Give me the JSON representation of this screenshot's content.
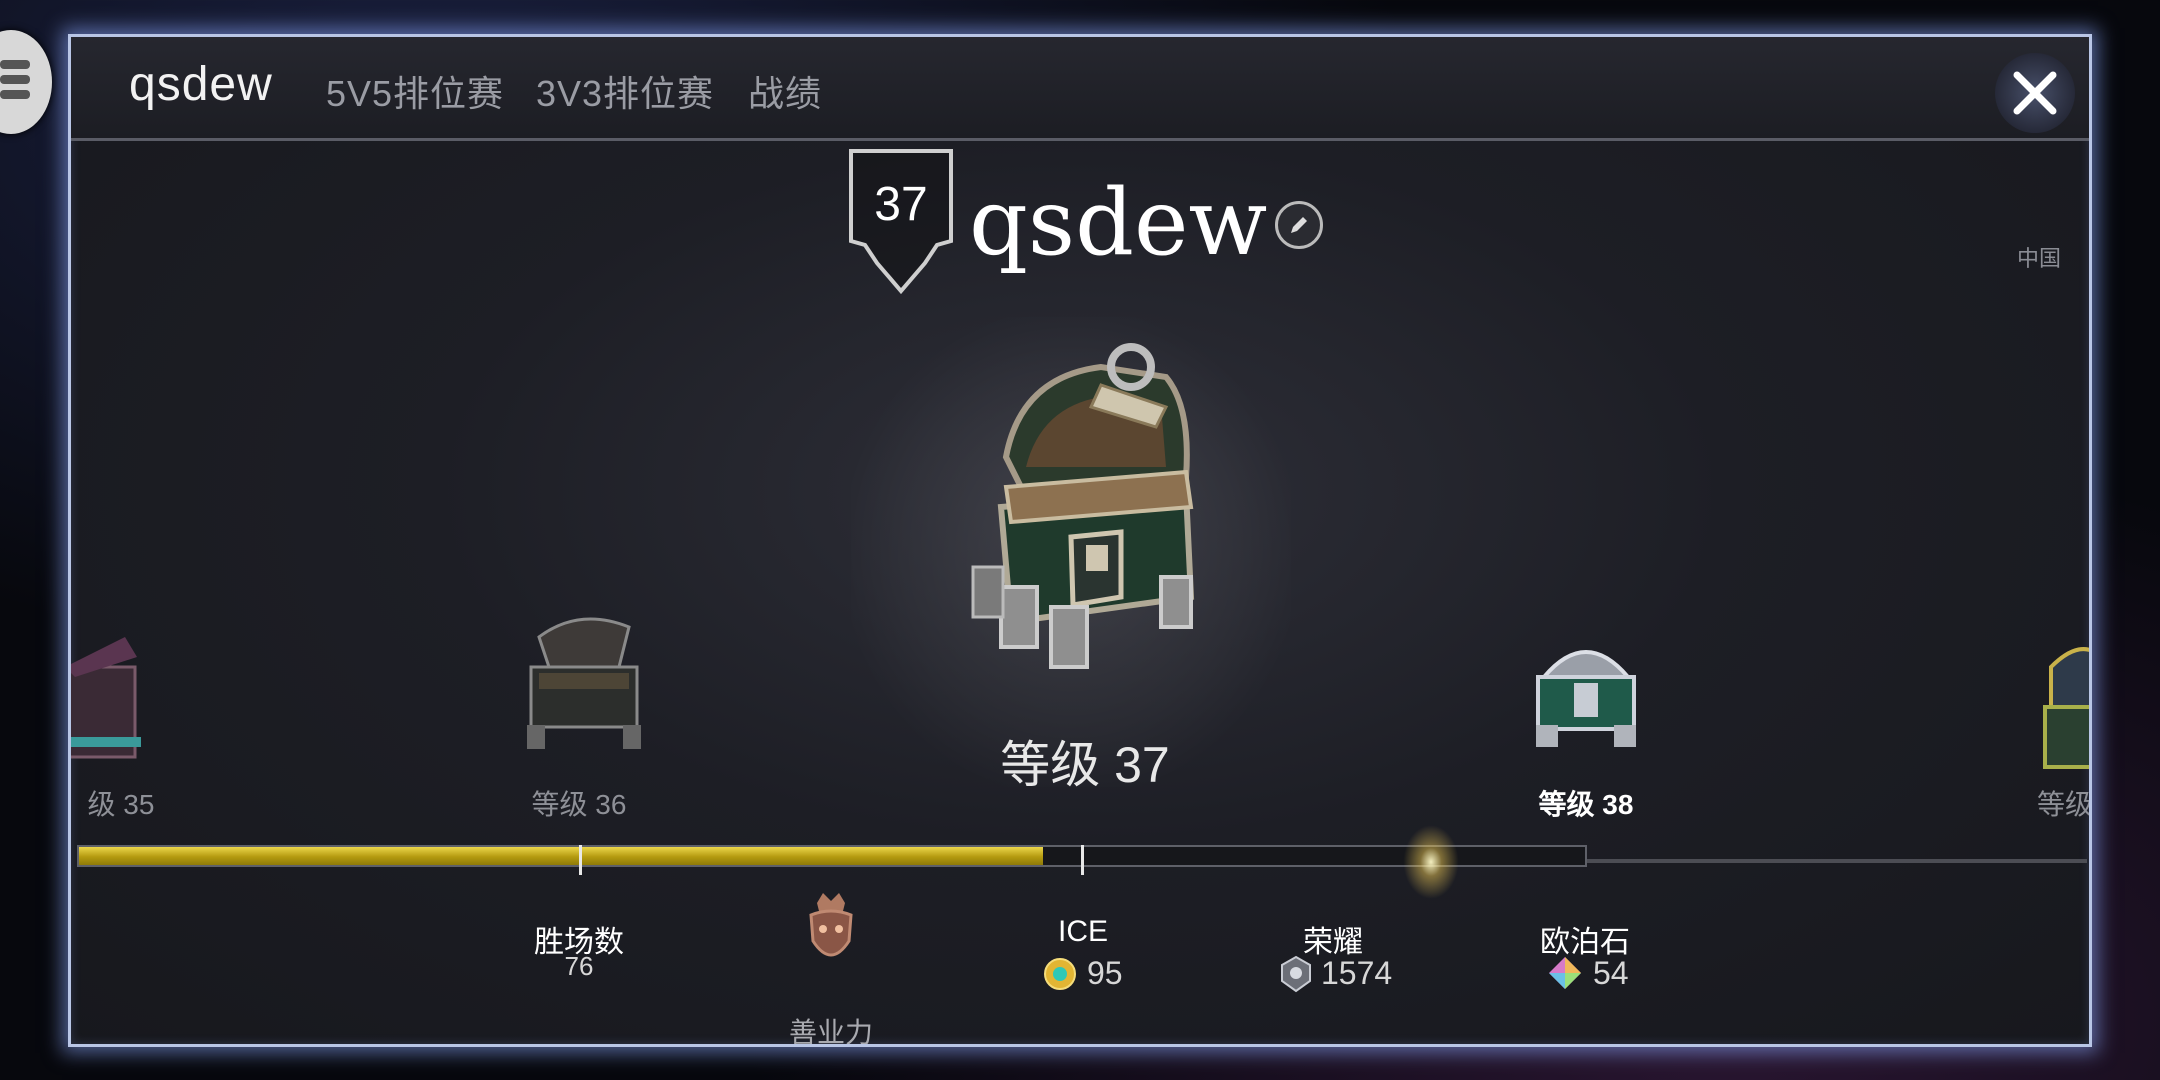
{
  "tabs": [
    {
      "label": "qsdew",
      "active": true
    },
    {
      "label": "5V5排位赛",
      "active": false
    },
    {
      "label": "3V3排位赛",
      "active": false
    },
    {
      "label": "战绩",
      "active": false
    }
  ],
  "region": "中国",
  "player": {
    "name": "qsdew",
    "level": "37"
  },
  "chests": {
    "prev2_label": "级 35",
    "prev_label": "等级 36",
    "current_label": "等级 37",
    "next_label": "等级 38",
    "next2_label": "等级"
  },
  "progress": {
    "fraction_of_bar": 0.64
  },
  "stats": {
    "wins_label": "胜场数",
    "wins_value": "76",
    "karma_label": "善业力",
    "ice_label": "ICE",
    "ice_value": "95",
    "glory_label": "荣耀",
    "glory_value": "1574",
    "opal_label": "欧泊石",
    "opal_value": "54"
  },
  "colors": {
    "accent_gold": "#e7cf3c",
    "panel_glow": "#b9c6e6"
  }
}
